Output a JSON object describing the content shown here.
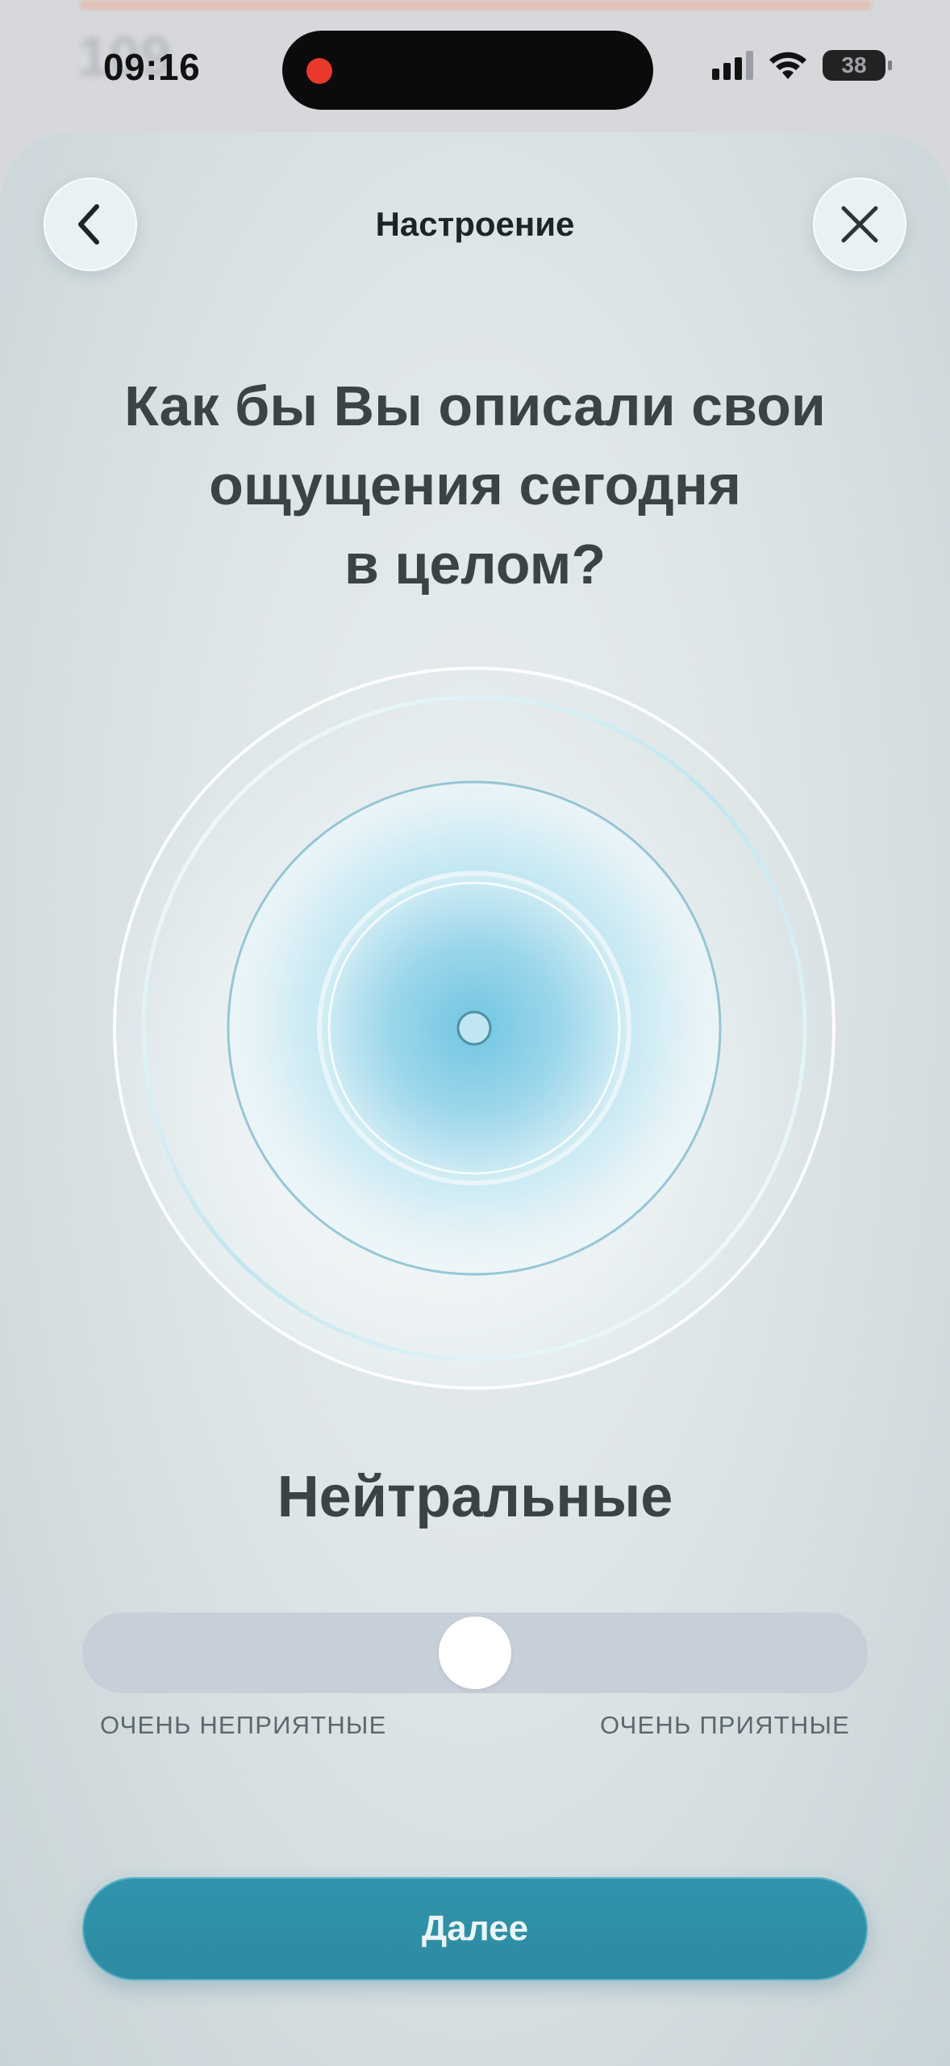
{
  "status_bar": {
    "time": "09:16",
    "battery": "38",
    "icons": [
      "recording-dot-icon",
      "signal-icon",
      "wifi-icon",
      "battery-icon"
    ]
  },
  "background": {
    "partial_number": "109"
  },
  "header": {
    "title": "Настроение",
    "back_icon": "chevron-left-icon",
    "close_icon": "close-icon"
  },
  "question": "Как бы Вы описали свои\nощущения сегодня\nв целом?",
  "mood": {
    "current_label": "Нейтральные",
    "slider_value": 0.5,
    "min_label": "ОЧЕНЬ НЕПРИЯТНЫЕ",
    "max_label": "ОЧЕНЬ ПРИЯТНЫЕ"
  },
  "actions": {
    "next_label": "Далее"
  },
  "colors": {
    "accent": "#2f8fa7",
    "text": "#3a4447",
    "slider_track": "#c7d0d8",
    "orb_center": "#7fcde6"
  }
}
